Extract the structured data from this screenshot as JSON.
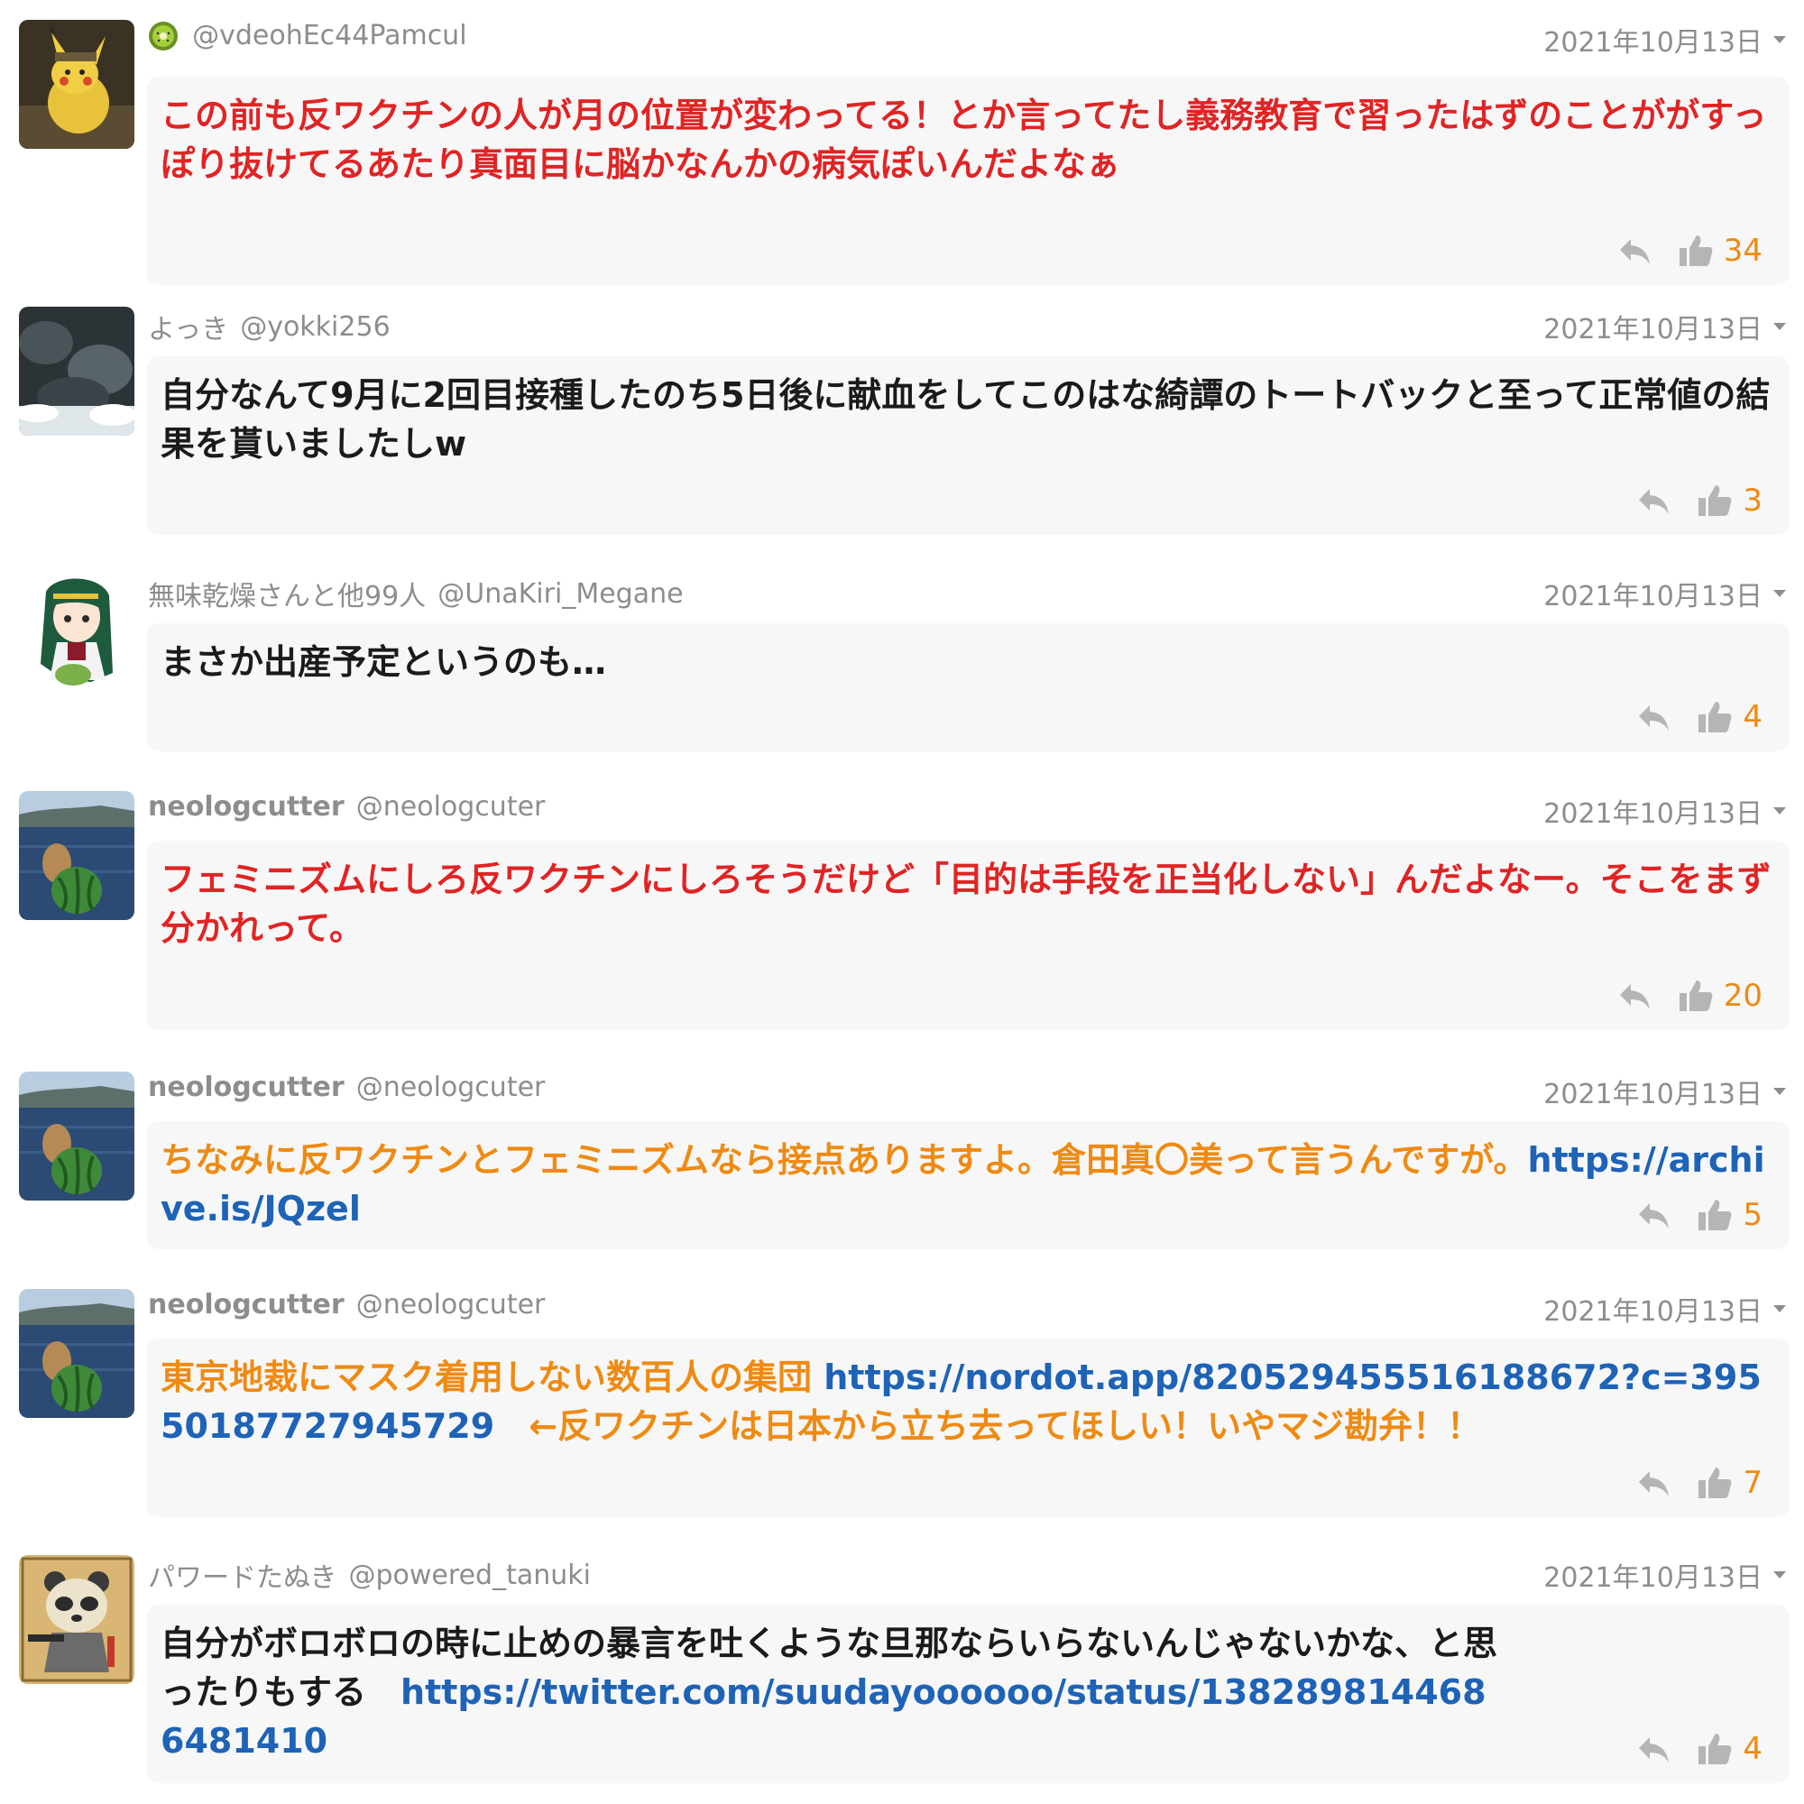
{
  "colors": {
    "meta_gray": "#8d8d8d",
    "bubble_bg": "#f7f7f8",
    "red_text": "#e02424",
    "orange_text": "#ef8a12",
    "link_blue": "#1e63b6",
    "like_orange": "#ef8a12"
  },
  "comments": [
    {
      "badge_icon": "kiwi-icon",
      "name": "",
      "handle": "@vdeohEc44Pamcul",
      "date": "2021年10月13日",
      "text": "この前も反ワクチンの人が月の位置が変わってる！とか言ってたし義務教育で習ったはずのことががすっぽり抜けてるあたり真面目に脳かなんかの病気ぽいんだよなぁ",
      "likes": "34"
    },
    {
      "name": "よっき",
      "handle": "@yokki256",
      "date": "2021年10月13日",
      "text": "自分なんて9月に2回目接種したのち5日後に献血をしてこのはな綺譚のトートバックと至って正常値の結果を貰いましたしw",
      "likes": "3"
    },
    {
      "name": "無味乾燥さんと他99人",
      "handle": "@UnaKiri_Megane",
      "date": "2021年10月13日",
      "text": "まさか出産予定というのも…",
      "likes": "4"
    },
    {
      "name": "neologcutter",
      "handle": "@neologcuter",
      "date": "2021年10月13日",
      "text": "フェミニズムにしろ反ワクチンにしろそうだけど「目的は手段を正当化しない」んだよなー。そこをまず分かれって。",
      "likes": "20"
    },
    {
      "name": "neologcutter",
      "handle": "@neologcuter",
      "date": "2021年10月13日",
      "text_part1": "ちなみに反ワクチンとフェミニズムなら接点ありますよ。倉田真〇美って言うんですが。",
      "link": "https://archive.is/JQzel",
      "likes": "5"
    },
    {
      "name": "neologcutter",
      "handle": "@neologcuter",
      "date": "2021年10月13日",
      "text_part1": "東京地裁にマスク着用しない数百人の集団 ",
      "link": "https://nordot.app/820529455516188672?c=39550187727945729",
      "text_part2": "　←反ワクチンは日本から立ち去ってほしい！いやマジ勘弁！！",
      "likes": "7"
    },
    {
      "name": "パワードたぬき",
      "handle": "@powered_tanuki",
      "date": "2021年10月13日",
      "text_part1": "自分がボロボロの時に止めの暴言を吐くような旦那ならいらないんじゃないかな、と思ったりもする　",
      "link": "https://twitter.com/suudayoooooo/status/1382898144686481410",
      "likes": "4"
    }
  ]
}
